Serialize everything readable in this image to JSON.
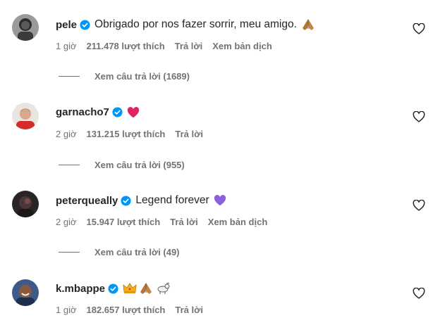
{
  "comments": [
    {
      "username": "pele",
      "verified": true,
      "text": "Obrigado por nos fazer sorrir, meu amigo.",
      "emojis": [
        "folded-hands"
      ],
      "time": "1 giờ",
      "likes": "211.478 lượt thích",
      "reply": "Trả lời",
      "translate": "Xem bản dịch",
      "view_replies": "Xem câu trả lời (1689)",
      "avatar": "grayscale-portrait"
    },
    {
      "username": "garnacho7",
      "verified": true,
      "text": "",
      "emojis": [
        "red-heart"
      ],
      "time": "2 giờ",
      "likes": "131.215 lượt thích",
      "reply": "Trả lời",
      "translate": "",
      "view_replies": "Xem câu trả lời (955)",
      "avatar": "red-jersey-portrait"
    },
    {
      "username": "peterqueally",
      "verified": true,
      "text": "Legend forever",
      "emojis": [
        "purple-heart"
      ],
      "time": "2 giờ",
      "likes": "15.947 lượt thích",
      "reply": "Trả lời",
      "translate": "Xem bản dịch",
      "view_replies": "Xem câu trả lời (49)",
      "avatar": "dark-portrait"
    },
    {
      "username": "k.mbappe",
      "verified": true,
      "text": "",
      "emojis": [
        "crown",
        "folded-hands",
        "goat"
      ],
      "time": "1 giờ",
      "likes": "182.657 lượt thích",
      "reply": "Trả lời",
      "translate": "",
      "view_replies": "",
      "avatar": "smiling-portrait"
    }
  ],
  "colors": {
    "text": "#262626",
    "secondary": "#737373",
    "verified_badge": "#0095f6",
    "red_heart": "#e0245e",
    "purple_heart": "#8b63d8"
  }
}
